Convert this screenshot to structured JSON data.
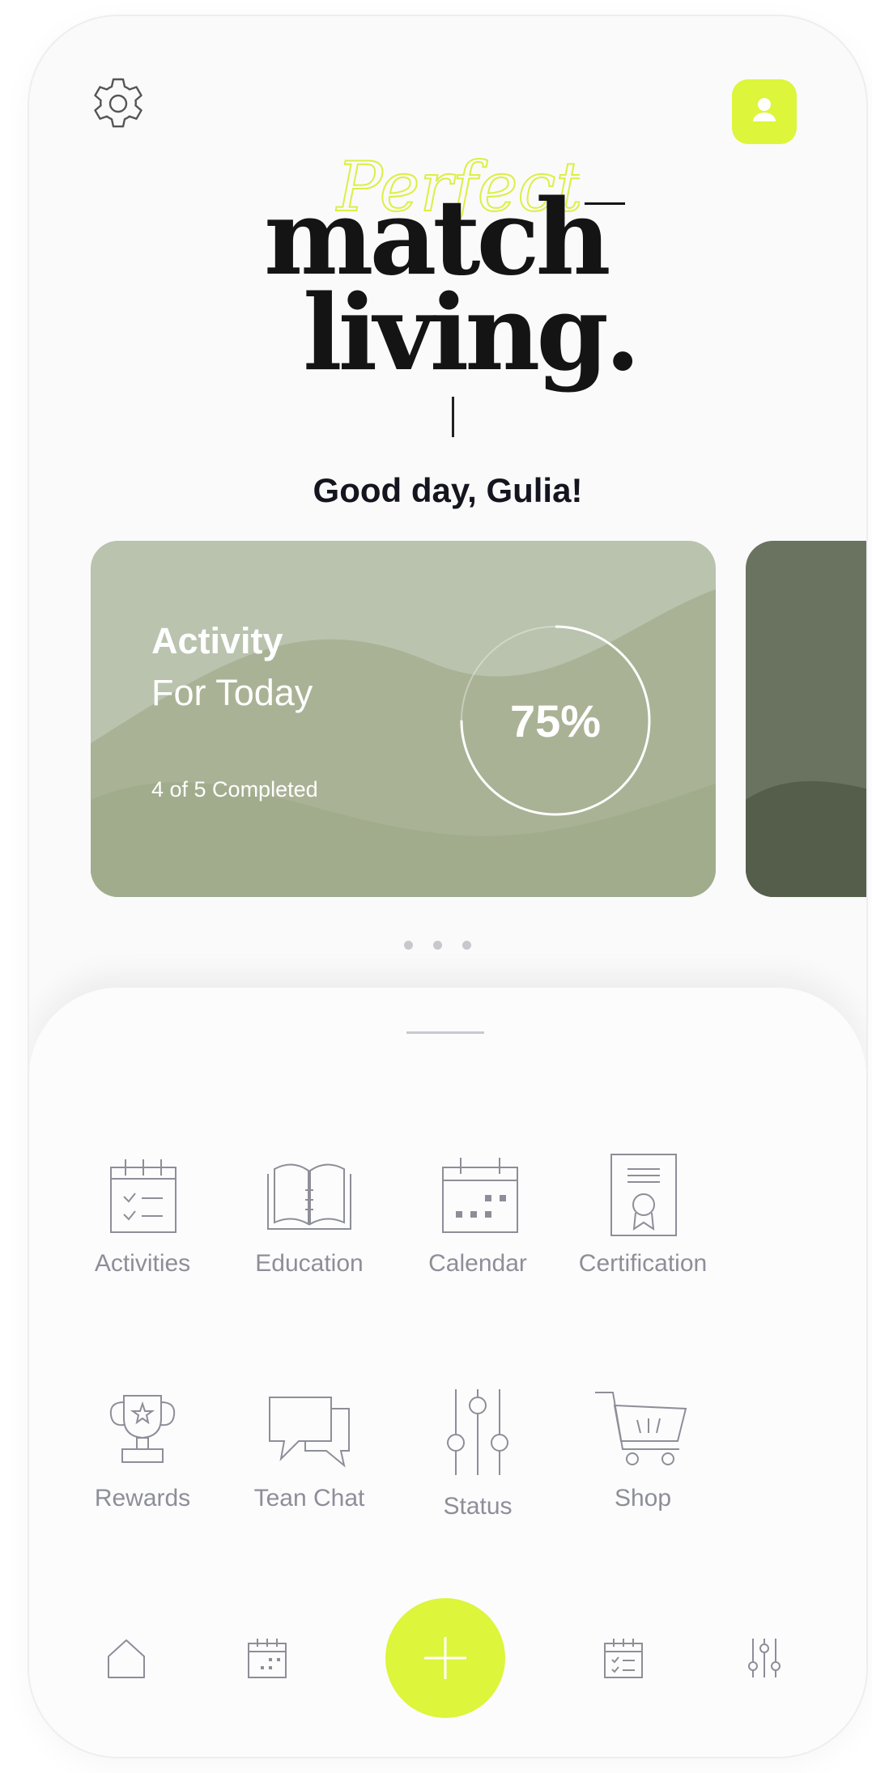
{
  "colors": {
    "accent": "#ddf53a",
    "card": "#b9c3ae",
    "card_dark": "#6a7360",
    "text_dark": "#15151f",
    "text_muted": "#8e8e99"
  },
  "header": {
    "settings_icon": "gear-icon",
    "profile_icon": "user-icon",
    "logo": {
      "script": "Perfect",
      "line1": "match",
      "line2": "living."
    }
  },
  "greeting": "Good day, Gulia!",
  "activity_card": {
    "title": "Activity",
    "subtitle": "For Today",
    "status": "4 of 5 Completed",
    "percent_label": "75%",
    "progress": 0.75
  },
  "carousel": {
    "pages": 3
  },
  "menu": [
    {
      "label": "Activities",
      "icon": "checklist-calendar-icon"
    },
    {
      "label": "Education",
      "icon": "book-icon"
    },
    {
      "label": "Calendar",
      "icon": "calendar-icon"
    },
    {
      "label": "Certification",
      "icon": "certificate-icon"
    },
    {
      "label": "Rewards",
      "icon": "trophy-icon"
    },
    {
      "label": "Tean Chat",
      "icon": "chat-icon"
    },
    {
      "label": "Status",
      "icon": "sliders-icon"
    },
    {
      "label": "Shop",
      "icon": "cart-icon"
    }
  ],
  "bottom_nav": {
    "items": [
      "home-icon",
      "calendar-icon",
      "plus-icon",
      "checklist-icon",
      "sliders-icon"
    ]
  }
}
